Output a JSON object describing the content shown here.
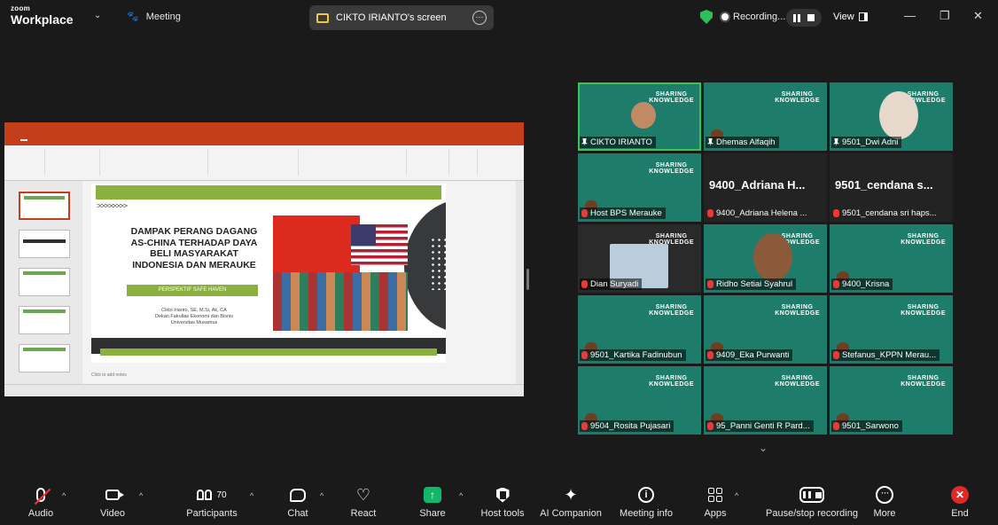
{
  "brand": {
    "logo_small": "zoom",
    "logo_main": "Workplace"
  },
  "topbar": {
    "meeting_label": "Meeting",
    "screen_share_label": "CIKTO IRIANTO's screen",
    "recording_label": "Recording...",
    "view_label": "View"
  },
  "slide": {
    "title": "DAMPAK PERANG DAGANG AS-CHINA TERHADAP DAYA BELI MASYARAKAT INDONESIA DAN MERAUKE",
    "subtitle": "PERSPEKTIF SAFE HAVEN",
    "author": "Cikto Irianto, SE, M.Si, Ak, CA",
    "faculty": "Dekan Fakultas Ekonomi dan Bisnis",
    "university": "Universitas Musamus",
    "notes_placeholder": "Click to add notes"
  },
  "participants": [
    {
      "name": "CIKTO IRIANTO",
      "icon": "pin-icon",
      "active": true
    },
    {
      "name": "Dhemas Alfaqih",
      "icon": "pin-icon"
    },
    {
      "name": "9501_Dwi Adni",
      "icon": "pin-icon"
    },
    {
      "name": "Host BPS Merauke",
      "icon": "mic-muted-icon"
    },
    {
      "name": "9400_Adriana Helena ...",
      "big_name": "9400_Adriana H...",
      "icon": "mic-muted-icon"
    },
    {
      "name": "9501_cendana sri haps...",
      "big_name": "9501_cendana s...",
      "icon": "mic-muted-icon"
    },
    {
      "name": "Dian Suryadi",
      "icon": "mic-muted-icon"
    },
    {
      "name": "Ridho Setiai Syahrul",
      "icon": "mic-muted-icon"
    },
    {
      "name": "9400_Krisna",
      "icon": "mic-muted-icon"
    },
    {
      "name": "9501_Kartika Fadinubun",
      "icon": "mic-muted-icon"
    },
    {
      "name": "9409_Eka Purwanti",
      "icon": "mic-muted-icon"
    },
    {
      "name": "Stefanus_KPPN Merau...",
      "icon": "mic-muted-icon"
    },
    {
      "name": "9504_Rosita Pujasari",
      "icon": "mic-muted-icon"
    },
    {
      "name": "95_Panni Genti R Pard...",
      "icon": "mic-muted-icon"
    },
    {
      "name": "9501_Sarwono",
      "icon": "mic-muted-icon"
    }
  ],
  "toolbar": {
    "audio": "Audio",
    "video": "Video",
    "participants": "Participants",
    "participants_count": "70",
    "chat": "Chat",
    "react": "React",
    "share": "Share",
    "host_tools": "Host tools",
    "ai_companion": "AI Companion",
    "meeting_info": "Meeting info",
    "apps": "Apps",
    "pause_stop": "Pause/stop recording",
    "more": "More",
    "end": "End"
  },
  "colors": {
    "tile_green": "#1e7d6a",
    "active_border": "#35c75a",
    "share_green": "#12b76a",
    "end_red": "#e02828",
    "ppt_orange": "#c43e1c",
    "slide_green": "#8ab040"
  }
}
